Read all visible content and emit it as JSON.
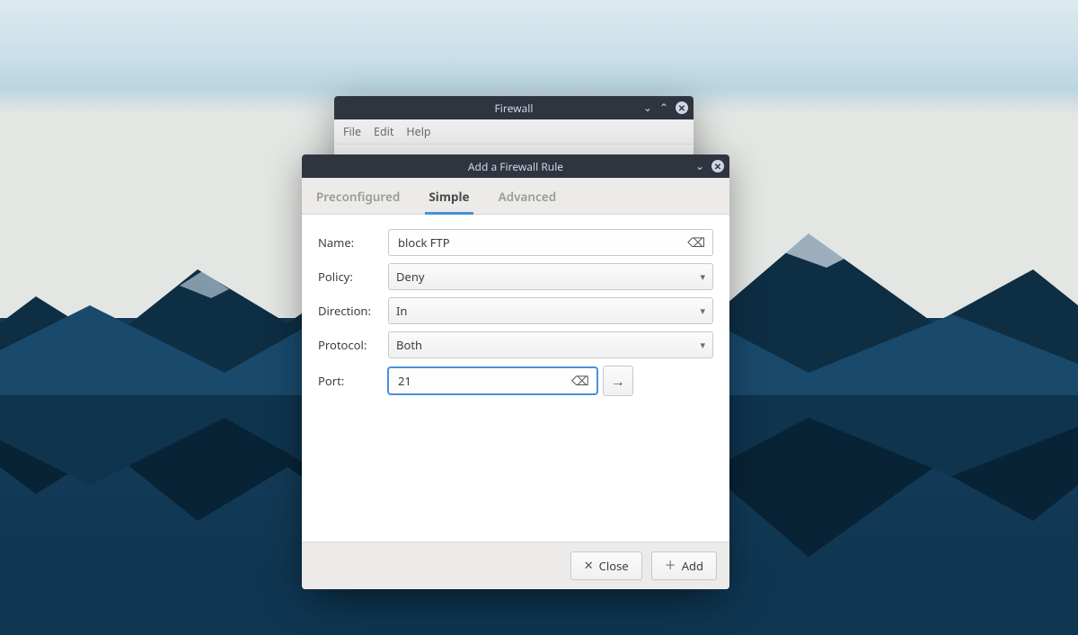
{
  "back_window": {
    "title": "Firewall",
    "menu": {
      "file": "File",
      "edit": "Edit",
      "help": "Help"
    }
  },
  "dialog": {
    "title": "Add a Firewall Rule",
    "tabs": {
      "preconfigured": "Preconfigured",
      "simple": "Simple",
      "advanced": "Advanced",
      "active": "simple"
    },
    "form": {
      "name_label": "Name:",
      "name_value": "block FTP",
      "policy_label": "Policy:",
      "policy_value": "Deny",
      "direction_label": "Direction:",
      "direction_value": "In",
      "protocol_label": "Protocol:",
      "protocol_value": "Both",
      "port_label": "Port:",
      "port_value": "21"
    },
    "footer": {
      "close": "Close",
      "add": "Add"
    }
  },
  "icons": {
    "clear": "⌫",
    "caret": "▾",
    "arrow_right": "→",
    "close_x": "✕",
    "plus": "＋",
    "chevron_down": "⌄",
    "chevron_up": "⌃"
  }
}
